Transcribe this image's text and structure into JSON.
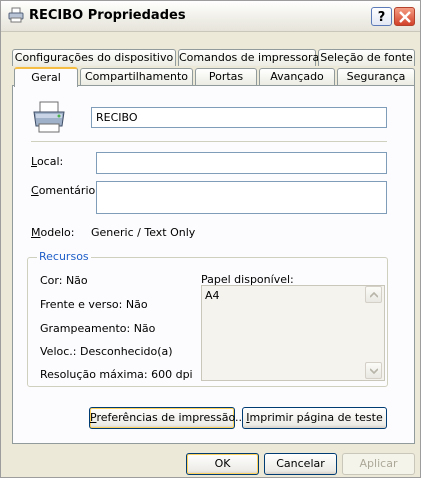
{
  "window": {
    "title": "RECIBO Propriedades",
    "help_label": "?",
    "close_icon": "close-icon"
  },
  "tabs_row1": [
    "Configurações do dispositivo",
    "Comandos de impressora",
    "Seleção de fonte"
  ],
  "tabs_row2": [
    "Geral",
    "Compartilhamento",
    "Portas",
    "Avançado",
    "Segurança"
  ],
  "selected_tab": "Geral",
  "printer": {
    "icon": "printer-icon",
    "name": "RECIBO"
  },
  "fields": {
    "local_label_pre": "",
    "local_label_u": "L",
    "local_label_post": "ocal:",
    "local_value": "",
    "comment_label_u": "C",
    "comment_label_post": "omentário:",
    "comment_value": "",
    "model_label_u": "M",
    "model_label_post": "odelo:",
    "model_value": "Generic / Text Only"
  },
  "resources": {
    "title": "Recursos",
    "color": "Cor: Não",
    "duplex": "Frente e verso: Não",
    "staple": "Grampeamento: Não",
    "speed": "Veloc.: Desconhecido(a)",
    "resolution": "Resolução máxima: 600 dpi",
    "paper_label": "Papel disponível:",
    "paper_items": [
      "A4"
    ]
  },
  "buttons": {
    "prefs_u": "P",
    "prefs_post": "referências de impressão...",
    "test_u": "I",
    "test_post": "mprimir página de teste",
    "ok": "OK",
    "cancel": "Cancelar",
    "apply": "Aplicar"
  },
  "colors": {
    "accent_tab": "#f6bd43",
    "group_title": "#1f5fc8",
    "window_bg": "#ece9d8"
  }
}
